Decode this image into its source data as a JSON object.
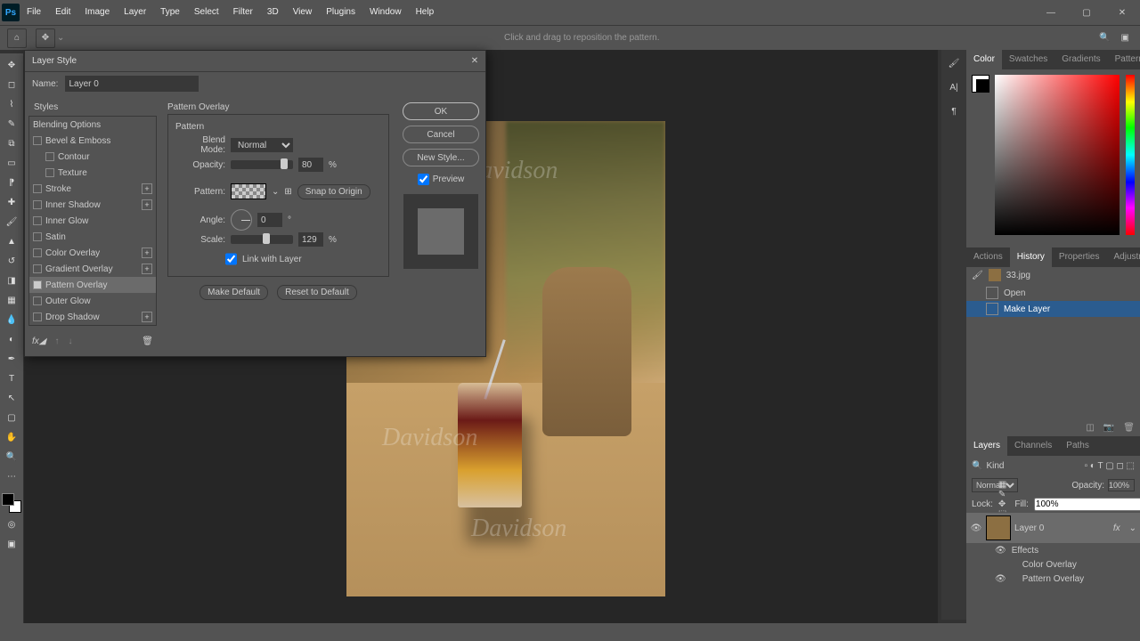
{
  "menu": [
    "File",
    "Edit",
    "Image",
    "Layer",
    "Type",
    "Select",
    "Filter",
    "3D",
    "View",
    "Plugins",
    "Window",
    "Help"
  ],
  "optbar_hint": "Click and drag to reposition the pattern.",
  "dialog": {
    "title": "Layer Style",
    "name_label": "Name:",
    "name_value": "Layer 0",
    "styles_header": "Styles",
    "blending_options": "Blending Options",
    "items": [
      {
        "label": "Bevel & Emboss",
        "checked": false,
        "plus": false
      },
      {
        "label": "Contour",
        "checked": false,
        "indent": true
      },
      {
        "label": "Texture",
        "checked": false,
        "indent": true
      },
      {
        "label": "Stroke",
        "checked": false,
        "plus": true
      },
      {
        "label": "Inner Shadow",
        "checked": false,
        "plus": true
      },
      {
        "label": "Inner Glow",
        "checked": false
      },
      {
        "label": "Satin",
        "checked": false
      },
      {
        "label": "Color Overlay",
        "checked": false,
        "plus": true
      },
      {
        "label": "Gradient Overlay",
        "checked": false,
        "plus": true
      },
      {
        "label": "Pattern Overlay",
        "checked": true,
        "active": true
      },
      {
        "label": "Outer Glow",
        "checked": false
      },
      {
        "label": "Drop Shadow",
        "checked": false,
        "plus": true
      }
    ],
    "section_title": "Pattern Overlay",
    "subsection": "Pattern",
    "blend_mode_label": "Blend Mode:",
    "blend_mode_value": "Normal",
    "opacity_label": "Opacity:",
    "opacity_value": "80",
    "pattern_label": "Pattern:",
    "snap": "Snap to Origin",
    "angle_label": "Angle:",
    "angle_value": "0",
    "scale_label": "Scale:",
    "scale_value": "129",
    "link_label": "Link with Layer",
    "make_default": "Make Default",
    "reset_default": "Reset to Default",
    "ok": "OK",
    "cancel": "Cancel",
    "new_style": "New Style...",
    "preview": "Preview",
    "percent": "%",
    "degree": "°"
  },
  "color_tabs": [
    "Color",
    "Swatches",
    "Gradients",
    "Patterns"
  ],
  "mid_tabs": [
    "Actions",
    "History",
    "Properties",
    "Adjustments"
  ],
  "doc_name": "33.jpg",
  "hist_items": [
    "Open",
    "Make Layer"
  ],
  "layers_tabs": [
    "Layers",
    "Channels",
    "Paths"
  ],
  "layer": {
    "kind": "Kind",
    "mode": "Normal",
    "opacity_label": "Opacity:",
    "opacity": "100%",
    "lock_label": "Lock:",
    "fill_label": "Fill:",
    "fill": "100%",
    "name": "Layer 0",
    "fx": "fx",
    "effects": "Effects",
    "fx_items": [
      "Color Overlay",
      "Pattern Overlay"
    ]
  }
}
